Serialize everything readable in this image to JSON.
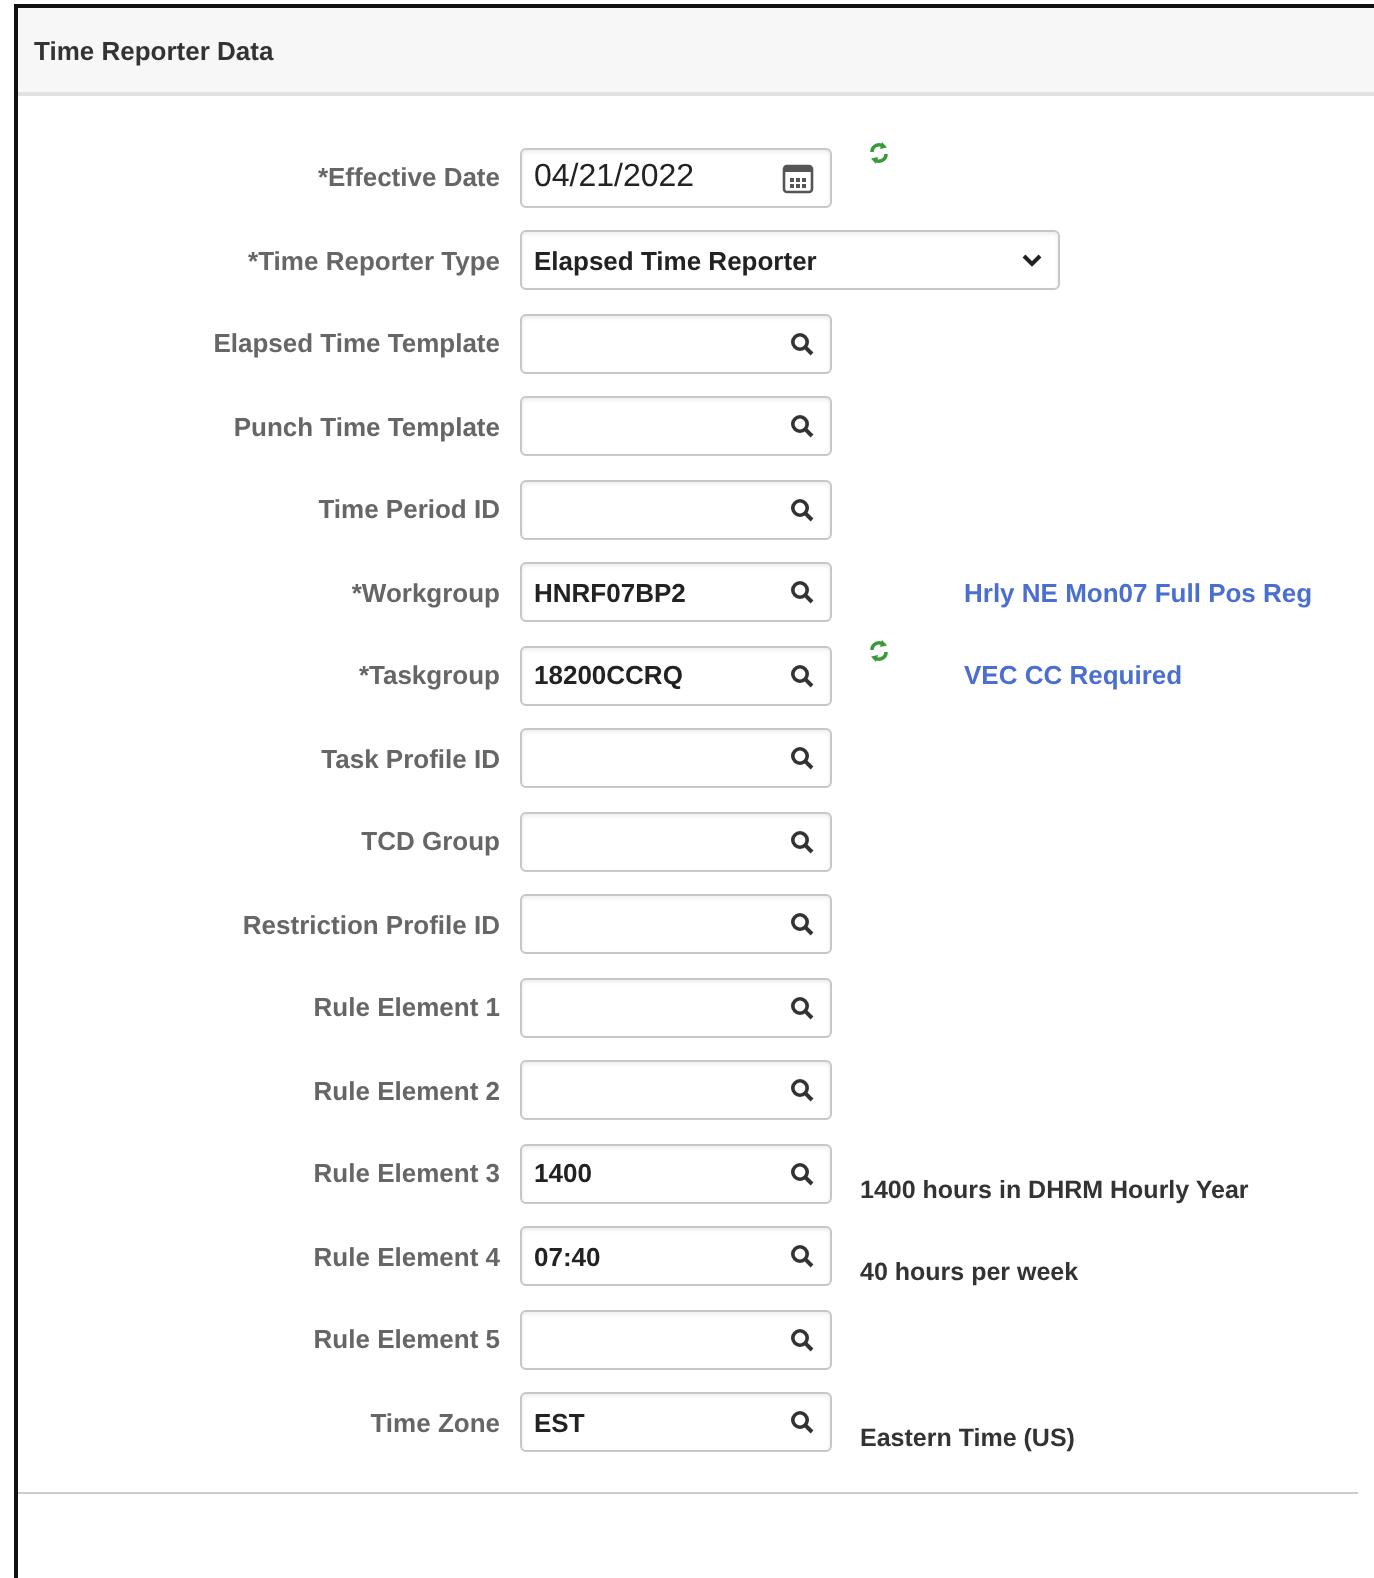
{
  "section": {
    "title": "Time Reporter Data"
  },
  "fields": [
    {
      "label": "*Effective Date",
      "kind": "date",
      "value": "04/21/2022",
      "refresh": true
    },
    {
      "label": "*Time Reporter Type",
      "kind": "select",
      "value": "Elapsed Time Reporter"
    },
    {
      "label": "Elapsed Time Template",
      "kind": "lookup"
    },
    {
      "label": "Punch Time Template",
      "kind": "lookup"
    },
    {
      "label": "Time Period ID",
      "kind": "lookup"
    },
    {
      "label": "*Workgroup",
      "kind": "lookup",
      "value": "HNRF07BP2",
      "note": {
        "kind": "link",
        "text": "Hrly NE Mon07 Full Pos Reg"
      }
    },
    {
      "label": "*Taskgroup",
      "kind": "lookup",
      "value": "18200CCRQ",
      "refresh": true,
      "note": {
        "kind": "link",
        "text": "VEC CC Required"
      }
    },
    {
      "label": "Task Profile ID",
      "kind": "lookup"
    },
    {
      "label": "TCD Group",
      "kind": "lookup"
    },
    {
      "label": "Restriction Profile ID",
      "kind": "lookup"
    },
    {
      "label": "Rule Element 1",
      "kind": "lookup"
    },
    {
      "label": "Rule Element 2",
      "kind": "lookup"
    },
    {
      "label": "Rule Element 3",
      "kind": "lookup",
      "value": "1400",
      "note": {
        "kind": "text",
        "text": "1400 hours in DHRM Hourly Year"
      }
    },
    {
      "label": "Rule Element 4",
      "kind": "lookup",
      "value": "07:40",
      "note": {
        "kind": "text",
        "text": "40 hours per week"
      }
    },
    {
      "label": "Rule Element 5",
      "kind": "lookup"
    },
    {
      "label": "Time Zone",
      "kind": "lookup",
      "value": "EST",
      "note": {
        "kind": "text",
        "text": "Eastern Time (US)"
      }
    }
  ]
}
